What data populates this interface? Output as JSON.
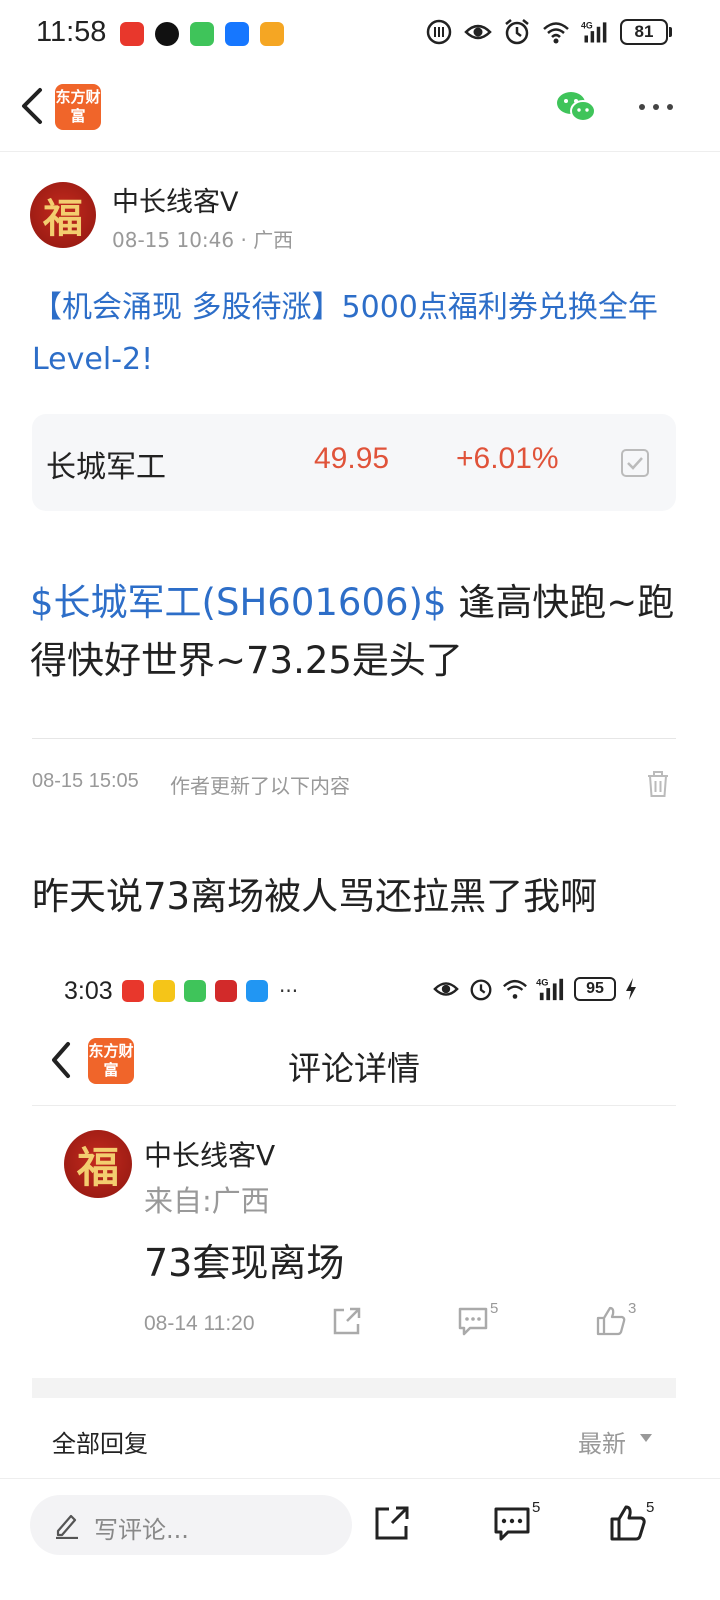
{
  "status_bar": {
    "time": "11:58",
    "network": "4G",
    "battery": "81",
    "apps": [
      "pinduoduo",
      "tiktok",
      "wechat",
      "alipay",
      "coupon-app"
    ]
  },
  "top_nav": {
    "brand_logo_text": "东方财富"
  },
  "post": {
    "author": "中长线客V",
    "avatar_char": "福",
    "date": "08-15 10:46",
    "separator": "·",
    "region": "广西",
    "promo": "【机会涌现 多股待涨】5000点福利券兑换全年Level-2!",
    "stock": {
      "name": "长城军工",
      "price": "49.95",
      "change": "+6.01%"
    },
    "ticker": "$长城军工(SH601606)$",
    "body": "逢高快跑~跑得快好世界~73.25是头了"
  },
  "update": {
    "time": "08-15 15:05",
    "note": "作者更新了以下内容",
    "text": "昨天说73离场被人骂还拉黑了我啊"
  },
  "embedded": {
    "time": "3:03",
    "network": "4G",
    "battery": "95",
    "more_apps": "···",
    "logo_text": "东方财富",
    "title": "评论详情",
    "author": "中长线客V",
    "avatar_char": "福",
    "from": "来自:广西",
    "comment": "73套现离场",
    "date": "08-14 11:20",
    "reply_count": "5",
    "like_count": "3",
    "all_replies": "全部回复",
    "sort": "最新"
  },
  "bottom_bar": {
    "comment_placeholder": "写评论...",
    "comment_count": "5",
    "like_count": "5"
  },
  "colors": {
    "link_blue": "#2d6ec8",
    "rise_red": "#e0533a",
    "brand_orange": "#f0652a",
    "wechat_green": "#3fc45a"
  }
}
